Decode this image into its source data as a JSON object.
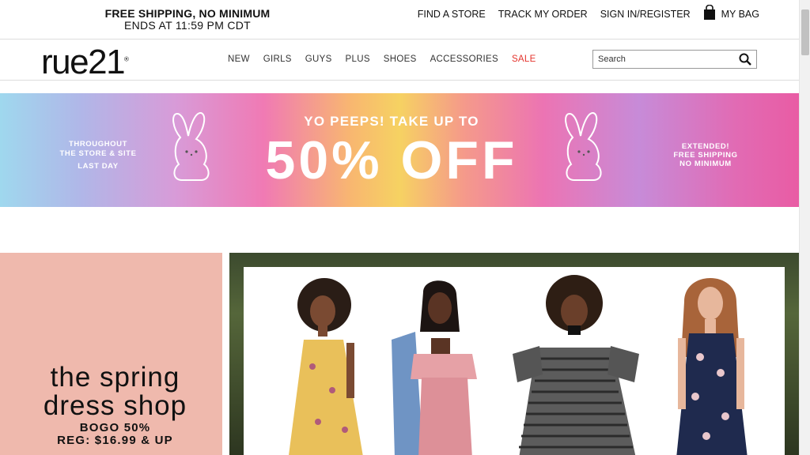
{
  "promo": {
    "line1": "FREE SHIPPING, NO MINIMUM",
    "line2": "ENDS AT 11:59 PM CDT"
  },
  "utility": {
    "find_store": "FIND A STORE",
    "track_order": "TRACK MY ORDER",
    "sign_in": "SIGN IN/REGISTER",
    "bag": "MY BAG"
  },
  "logo": {
    "text": "rue21",
    "mark": "®"
  },
  "nav": {
    "items": [
      "NEW",
      "GIRLS",
      "GUYS",
      "PLUS",
      "SHOES",
      "ACCESSORIES",
      "SALE"
    ]
  },
  "search": {
    "placeholder": "Search"
  },
  "hero": {
    "left_line1": "THROUGHOUT",
    "left_line2": "THE STORE & SITE",
    "left_line3": "LAST DAY",
    "headline": "YO PEEPS! TAKE UP TO",
    "big": "50% OFF",
    "right_line1": "EXTENDED!",
    "right_line2": "FREE SHIPPING",
    "right_line3": "NO MINIMUM"
  },
  "dress_shop": {
    "title1": "the spring",
    "title2": "dress shop",
    "bogo": "BOGO 50%",
    "reg": "REG: $16.99 & UP"
  },
  "colors": {
    "sale": "#e4322b",
    "pink_panel": "#efb9ad"
  },
  "icons": [
    "bag-icon",
    "search-icon",
    "bunny-icon"
  ]
}
